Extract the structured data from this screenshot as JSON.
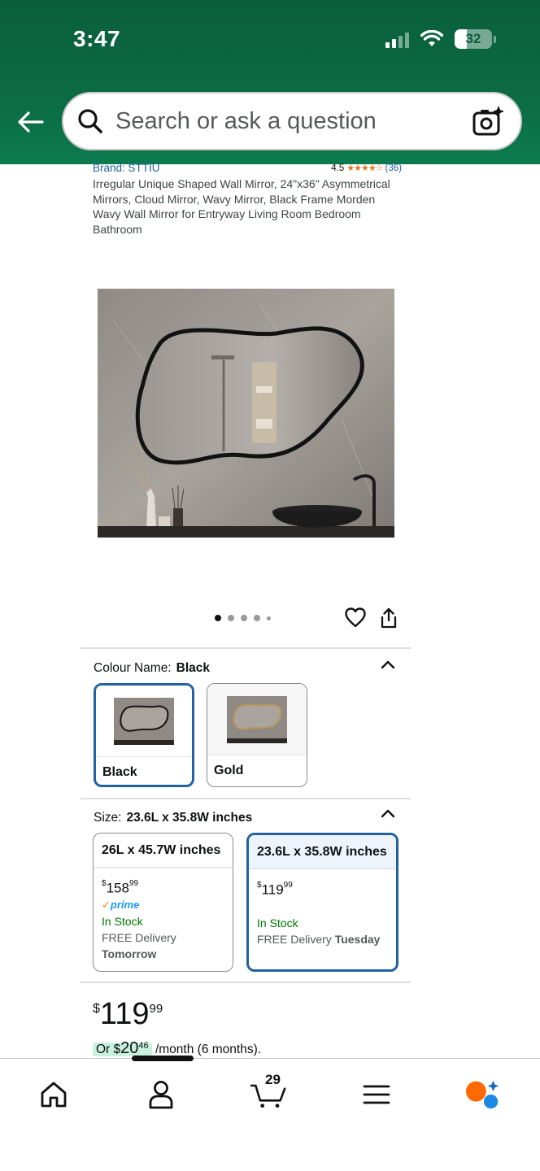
{
  "status_bar": {
    "time": "3:47",
    "battery": "32"
  },
  "search": {
    "placeholder": "Search or ask a question"
  },
  "product": {
    "brand": "Brand: STTIU",
    "rating": "4.5",
    "stars": "★★★★☆",
    "review_count": "(36)",
    "title": "Irregular Unique Shaped Wall Mirror, 24\"x36\" Asymmetrical Mirrors, Cloud Mirror, Wavy Mirror, Black Frame Morden Wavy Wall Mirror for Entryway Living Room Bedroom Bathroom"
  },
  "carousel": {
    "total": 5,
    "active_index": 0
  },
  "colour": {
    "label": "Colour Name:",
    "selected": "Black",
    "options": [
      {
        "label": "Black",
        "frame_color": "#1a1a1a"
      },
      {
        "label": "Gold",
        "frame_color": "#b8955a"
      }
    ]
  },
  "size": {
    "label": "Size:",
    "selected": "23.6L x 35.8W inches",
    "options": [
      {
        "label": "26L x 45.7W inches",
        "currency": "$",
        "price_whole": "158",
        "price_cents": "99",
        "prime": "prime",
        "stock": "In Stock",
        "delivery_prefix": "FREE Delivery",
        "delivery_day": "Tomorrow"
      },
      {
        "label": "23.6L x 35.8W inches",
        "currency": "$",
        "price_whole": "119",
        "price_cents": "99",
        "stock": "In Stock",
        "delivery_prefix": "FREE Delivery",
        "delivery_day": "Tuesday"
      }
    ]
  },
  "price": {
    "currency": "$",
    "whole": "119",
    "cents": "99",
    "monthly_prefix": "Or ",
    "monthly_currency": "$",
    "monthly_whole": "20",
    "monthly_cents": "46",
    "monthly_suffix": " /month (6 months)."
  },
  "bottom_nav": {
    "cart_count": "29"
  },
  "colors": {
    "header_green": "#0b6b45",
    "link_blue": "#2162a1",
    "in_stock_green": "#007600",
    "star_orange": "#de7921"
  }
}
